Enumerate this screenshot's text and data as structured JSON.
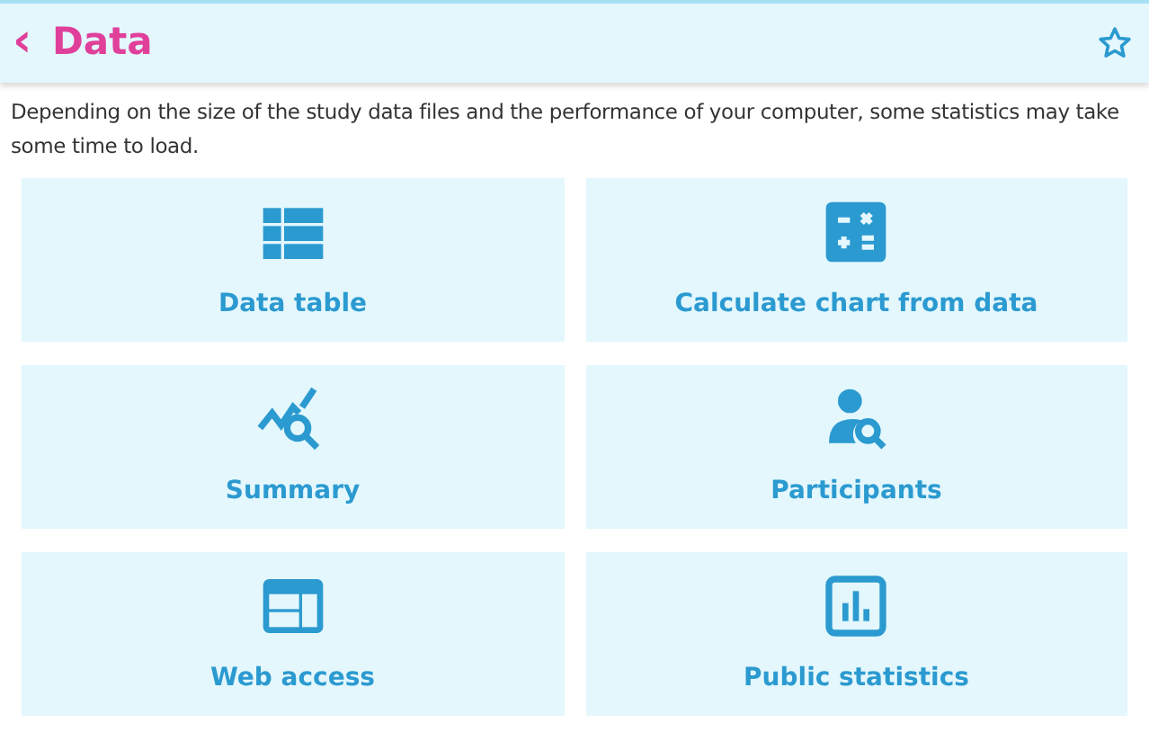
{
  "header": {
    "back": "‹",
    "title": "Data"
  },
  "notice": "Depending on the size of the study data files and the performance of your computer, some statistics may take some time to load.",
  "tiles": [
    {
      "kind": "table",
      "label": "Data table"
    },
    {
      "kind": "calculator",
      "label": "Calculate chart from data"
    },
    {
      "kind": "trend",
      "label": "Summary"
    },
    {
      "kind": "person",
      "label": "Participants"
    },
    {
      "kind": "layout",
      "label": "Web access"
    },
    {
      "kind": "bars",
      "label": "Public statistics"
    }
  ]
}
